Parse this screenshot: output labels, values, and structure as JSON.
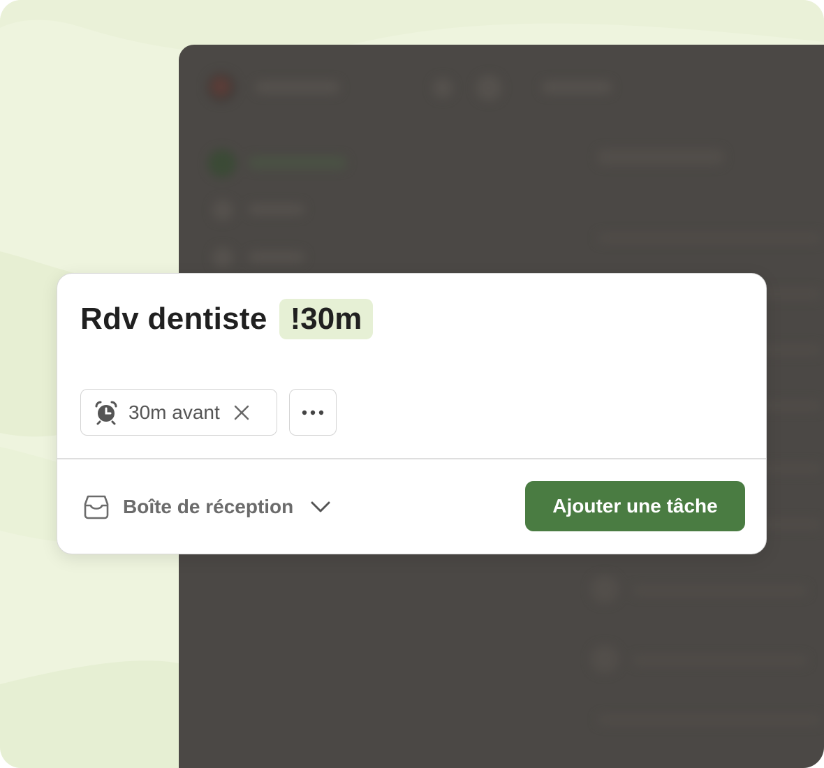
{
  "quick_add": {
    "task_name": "Rdv dentiste",
    "duration_tag": "!30m",
    "reminder_chip": {
      "label": "30m avant",
      "icon": "alarm-clock-icon",
      "remove_icon": "close-icon"
    },
    "more_options_icon": "more-horizontal-icon",
    "project": {
      "label": "Boîte de réception",
      "icon": "inbox-tray-icon",
      "chevron_icon": "chevron-down-icon"
    },
    "submit_label": "Ajouter une tâche"
  },
  "colors": {
    "accent_green": "#4a7c42",
    "tag_background": "#e6f0d5",
    "page_background": "#eef4de",
    "app_background": "#4b4845"
  }
}
